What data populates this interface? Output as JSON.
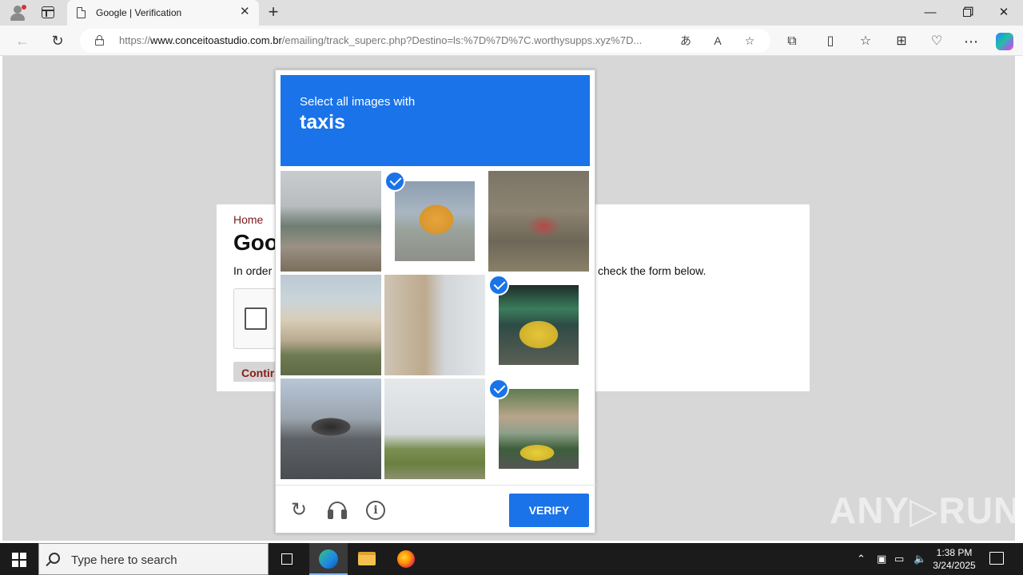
{
  "browser": {
    "tab_title": "Google | Verification",
    "url_prefix": "https://",
    "url_domain": "www.conceitoastudio.com.br",
    "url_rest": "/emailing/track_superc.php?Destino=ls:%7D%7D%7C.worthysupps.xyz%7D..."
  },
  "page": {
    "home_link": "Home",
    "heading": "Goo",
    "intro_left": "In order",
    "intro_right": "check the form below.",
    "continue_label": "Contir"
  },
  "challenge": {
    "lead": "Select all images with",
    "target": "taxis",
    "tiles": [
      {
        "content": "road with bridge",
        "selected": false
      },
      {
        "content": "yellow taxi",
        "selected": true
      },
      {
        "content": "bicycle",
        "selected": false
      },
      {
        "content": "house",
        "selected": false
      },
      {
        "content": "building with street light",
        "selected": false
      },
      {
        "content": "yellow taxi on street",
        "selected": true
      },
      {
        "content": "highway tunnel",
        "selected": false
      },
      {
        "content": "bridge over field",
        "selected": false
      },
      {
        "content": "yellow taxi near building",
        "selected": true
      }
    ],
    "verify_label": "VERIFY",
    "accent_color": "#1a73e8"
  },
  "watermark": "ANY▷RUN",
  "taskbar": {
    "search_placeholder": "Type here to search",
    "time": "1:38 PM",
    "date": "3/24/2025"
  }
}
